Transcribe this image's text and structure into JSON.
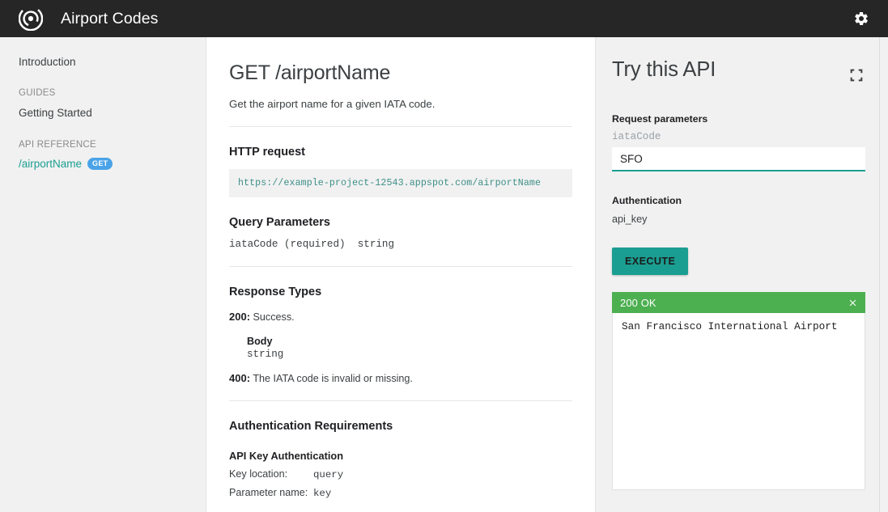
{
  "header": {
    "logo_icon": "target-spiral-logo-icon",
    "title": "Airport Codes",
    "settings_icon": "gear-icon"
  },
  "sidebar": {
    "introduction_label": "Introduction",
    "guides_section_label": "GUIDES",
    "getting_started_label": "Getting Started",
    "api_reference_section_label": "API REFERENCE",
    "endpoint_label": "/airportName",
    "endpoint_method_badge": "GET"
  },
  "doc": {
    "title": "GET /airportName",
    "lead": "Get the airport name for a given IATA code.",
    "http_request_heading": "HTTP request",
    "http_request_url": "https://example-project-12543.appspot.com/airportName",
    "query_parameters_heading": "Query Parameters",
    "query_parameter_line": "iataCode (required)  string",
    "response_types_heading": "Response Types",
    "response_200_code": "200:",
    "response_200_text": "Success.",
    "body_label": "Body",
    "body_type": "string",
    "response_400_code": "400:",
    "response_400_text": "The IATA code is invalid or missing.",
    "auth_requirements_heading": "Authentication Requirements",
    "api_key_auth_heading": "API Key Authentication",
    "key_location_label": "Key location:",
    "key_location_value": "query",
    "parameter_name_label": "Parameter name:",
    "parameter_name_value": "key"
  },
  "try_panel": {
    "title": "Try this API",
    "expand_icon": "fullscreen-expand-icon",
    "request_parameters_label": "Request parameters",
    "param_name": "iataCode",
    "param_value": "SFO",
    "param_placeholder": "iataCode",
    "authentication_label": "Authentication",
    "authentication_value": "api_key",
    "execute_label": "EXECUTE",
    "response_status": "200 OK",
    "response_close_icon": "close-x-icon",
    "response_body": "San Francisco International Airport"
  },
  "colors": {
    "topbar_bg": "#262626",
    "accent_teal": "#1a9e91",
    "status_green": "#4caf50",
    "method_badge_blue": "#4aa3e8",
    "panel_bg": "#f1f1f1"
  }
}
